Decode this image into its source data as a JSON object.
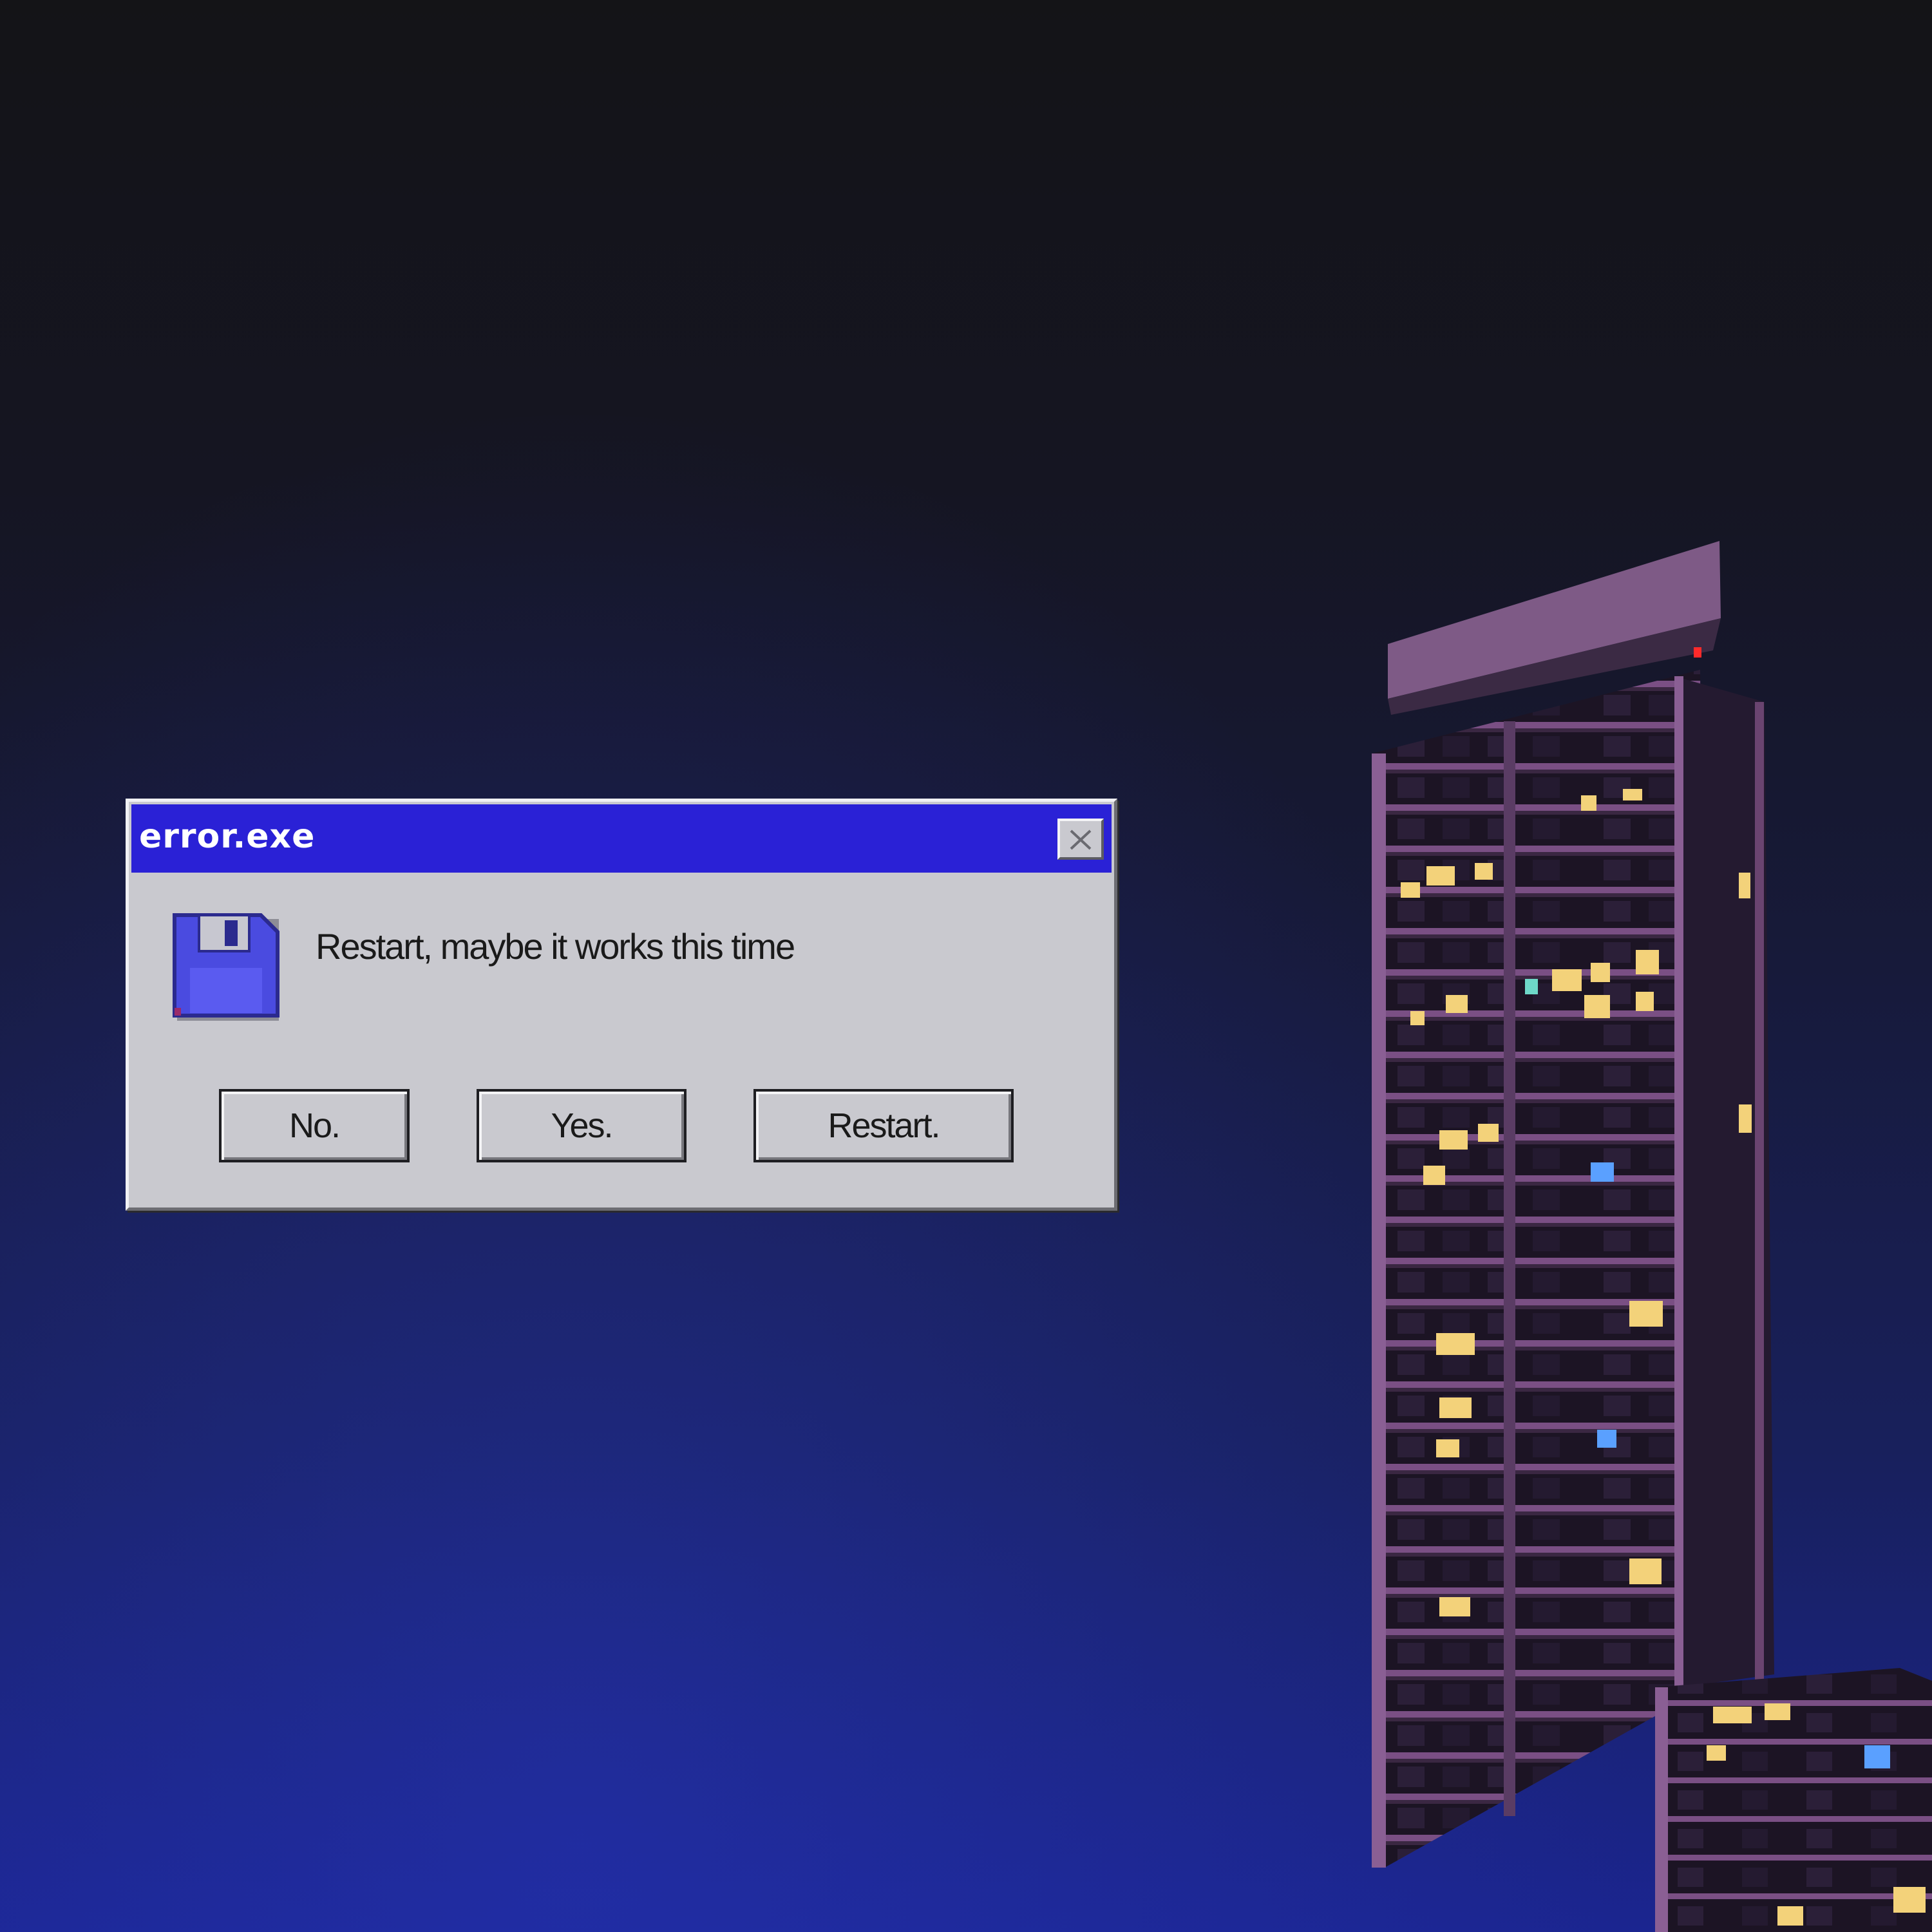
{
  "dialog": {
    "title": "error.exe",
    "message": "Restart, maybe it works this time",
    "buttons": {
      "no": "No.",
      "yes": "Yes.",
      "restart": "Restart."
    },
    "icons": {
      "close": "close-icon",
      "message": "floppy-disk-icon"
    }
  },
  "colors": {
    "titlebar": "#2a21d6",
    "dialog_face": "#c9c9cf",
    "floppy": "#4a4be0",
    "sky_top": "#141417",
    "sky_bottom": "#1b2590",
    "building": "#6a4470"
  }
}
